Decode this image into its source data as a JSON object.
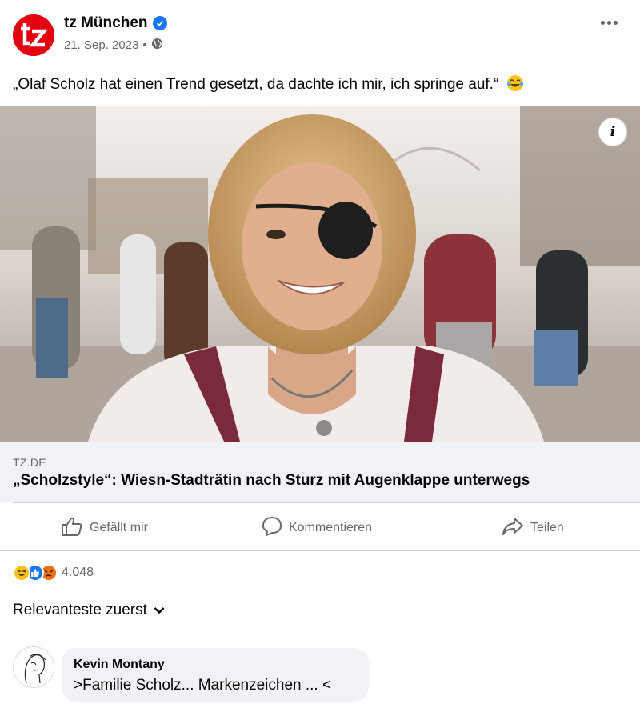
{
  "post": {
    "page_name": "tz München",
    "date": "21. Sep. 2023",
    "separator": "•",
    "text": "„Olaf Scholz hat einen Trend gesetzt, da dachte ich mir, ich springe auf.“",
    "icons": {
      "page_logo": "tz-logo-icon",
      "verified": "verified-badge-icon",
      "audience": "globe-icon",
      "emoji": "laughing-tears-emoji-icon",
      "info": "info-icon"
    }
  },
  "link": {
    "domain": "TZ.DE",
    "title": "„Scholzstyle“: Wiesn-Stadträtin nach Sturz mit Augenklappe unterwegs"
  },
  "actions": {
    "like_label": "Gefällt mir",
    "comment_label": "Kommentieren",
    "share_label": "Teilen"
  },
  "reactions": {
    "count": "4.048",
    "types": [
      "haha",
      "like",
      "angry"
    ]
  },
  "comments": {
    "sort_label": "Relevanteste zuerst",
    "items": [
      {
        "author": "Kevin Montany",
        "text": ">Familie Scholz... Markenzeichen ... <"
      }
    ]
  },
  "colors": {
    "accent": "#1877f2",
    "brand_red": "#e3000f",
    "secondary_text": "#65676b",
    "link_bg": "#f0f2f5"
  }
}
